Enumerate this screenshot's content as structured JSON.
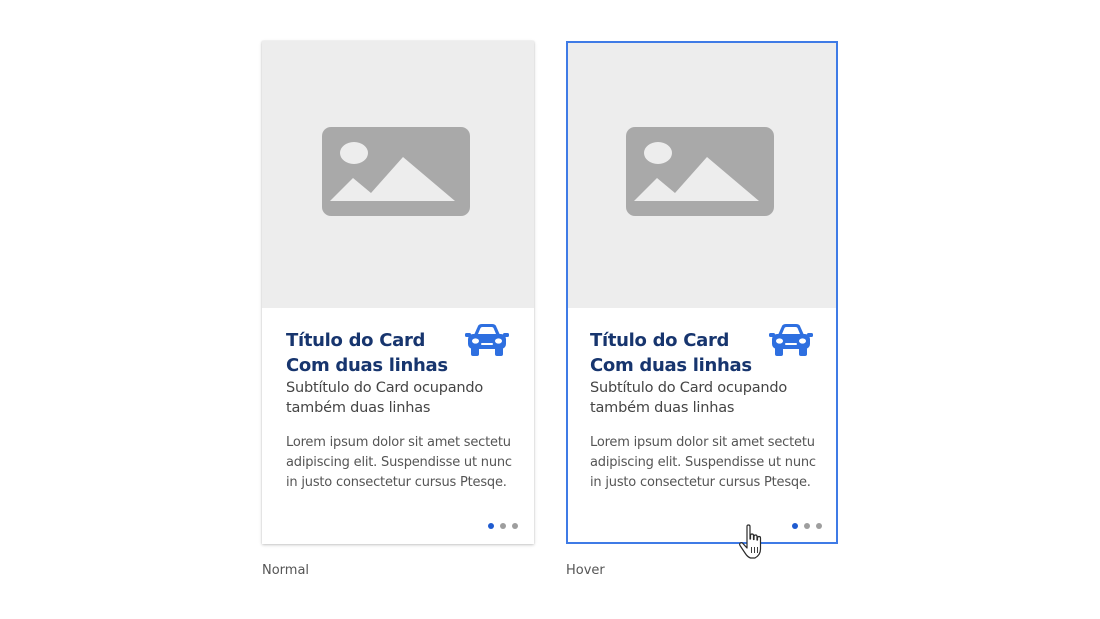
{
  "cards": [
    {
      "state": "Normal",
      "title_line1": "Título do Card",
      "title_line2": "Com duas linhas",
      "subtitle_line1": "Subtítulo do Card ocupando",
      "subtitle_line2": "também duas linhas",
      "body_line1": "Lorem ipsum dolor sit amet sectetu",
      "body_line2": "adipiscing elit. Suspendisse ut nunc",
      "body_line3": "in justo consectetur cursus Ptesqe.",
      "icon": "car-icon",
      "dots": 3,
      "active_dot": 1
    },
    {
      "state": "Hover",
      "title_line1": "Título do Card",
      "title_line2": "Com duas linhas",
      "subtitle_line1": "Subtítulo do Card ocupando",
      "subtitle_line2": "também duas linhas",
      "body_line1": "Lorem ipsum dolor sit amet sectetu",
      "body_line2": "adipiscing elit. Suspendisse ut nunc",
      "body_line3": "in justo consectetur cursus Ptesqe.",
      "icon": "car-icon",
      "dots": 3,
      "active_dot": 1
    }
  ],
  "colors": {
    "title": "#17356e",
    "accent": "#3f7be6",
    "active_dot": "#1f5bd0",
    "placeholder_bg": "#ededed",
    "placeholder_icon": "#a9a9a9"
  },
  "cursor_icon": "hand-pointer-icon"
}
